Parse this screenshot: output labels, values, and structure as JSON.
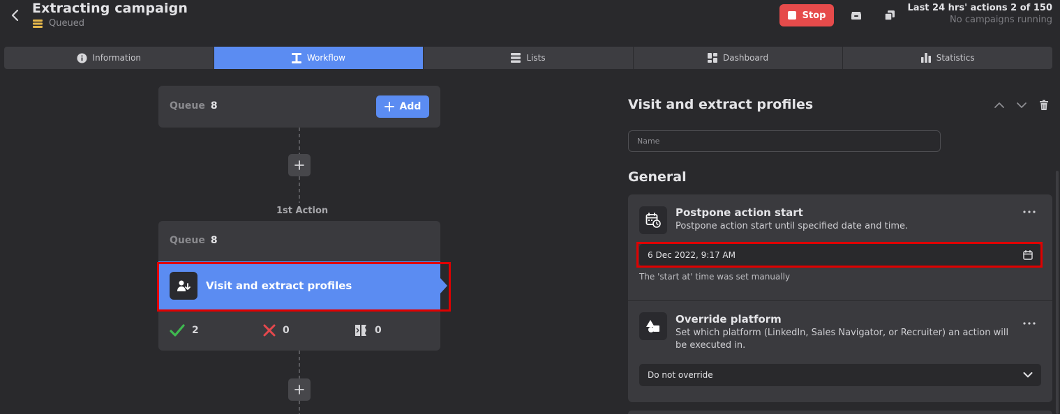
{
  "header": {
    "title": "Extracting campaign",
    "status": "Queued",
    "stop_label": "Stop",
    "actions_stat": "Last 24 hrs' actions 2 of 150",
    "running_stat": "No campaigns running"
  },
  "tabs": [
    {
      "label": "Information",
      "icon": "info-icon"
    },
    {
      "label": "Workflow",
      "icon": "workflow-icon",
      "active": true
    },
    {
      "label": "Lists",
      "icon": "list-icon"
    },
    {
      "label": "Dashboard",
      "icon": "dashboard-icon"
    },
    {
      "label": "Statistics",
      "icon": "bar-chart-icon"
    }
  ],
  "workflow": {
    "top_queue": {
      "label": "Queue",
      "count": "8"
    },
    "add_label": "Add",
    "first_action_label": "1st Action",
    "action": {
      "queue_label": "Queue",
      "queue_count": "8",
      "name": "Visit and extract profiles",
      "success_count": "2",
      "failed_count": "0",
      "skipped_count": "0"
    }
  },
  "panel": {
    "title": "Visit and extract profiles",
    "name_placeholder": "Name",
    "section": "General",
    "postpone": {
      "title": "Postpone action start",
      "description": "Postpone action start until specified date and time.",
      "value": "6 Dec 2022, 9:17 AM",
      "note": "The 'start at' time was set manually"
    },
    "override": {
      "title": "Override platform",
      "description": "Set which platform (LinkedIn, Sales Navigator, or Recruiter) an action will be executed in.",
      "value": "Do not override"
    }
  },
  "colors": {
    "accent": "#5b8cf2",
    "stop": "#e64b4b",
    "success": "#3fb950",
    "failed": "#e5484d",
    "queued": "#e6b84b",
    "highlight": "#e00000"
  }
}
